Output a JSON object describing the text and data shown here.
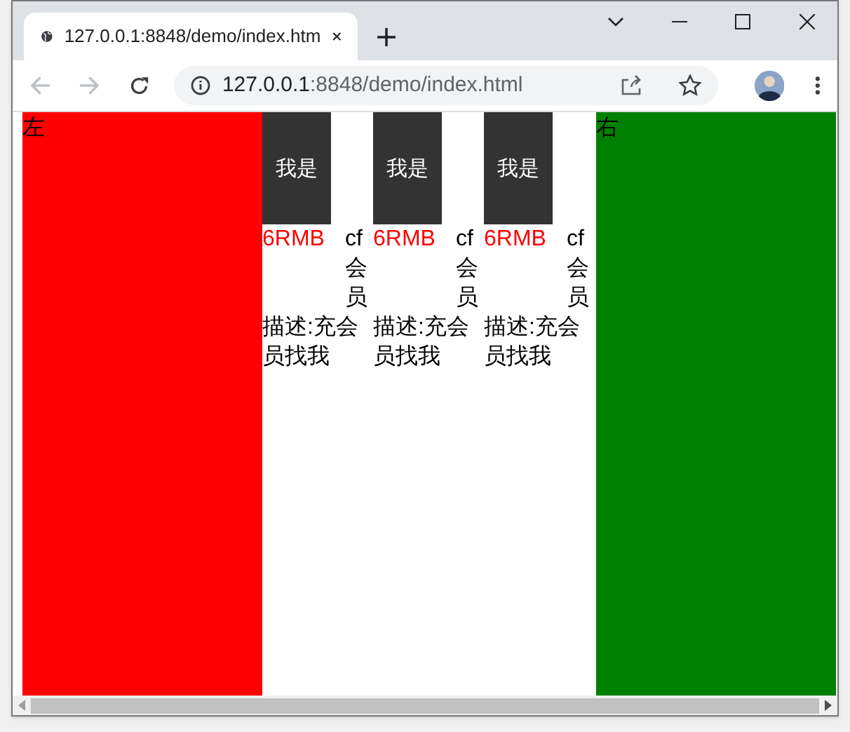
{
  "browser": {
    "tab": {
      "title": "127.0.0.1:8848/demo/index.htm",
      "selected": true
    },
    "address": {
      "host": "127.0.0.1",
      "path": ":8848/demo/index.html"
    }
  },
  "page": {
    "left_panel": {
      "label": "左"
    },
    "products": [
      {
        "image_label": "我是",
        "price": "6RMB",
        "name": "cf会员",
        "description": "描述:充会员找我"
      },
      {
        "image_label": "我是",
        "price": "6RMB",
        "name": "cf会员",
        "description": "描述:充会员找我"
      },
      {
        "image_label": "我是",
        "price": "6RMB",
        "name": "cf会员",
        "description": "描述:充会员找我"
      }
    ],
    "right_panel": {
      "label": "右"
    }
  }
}
